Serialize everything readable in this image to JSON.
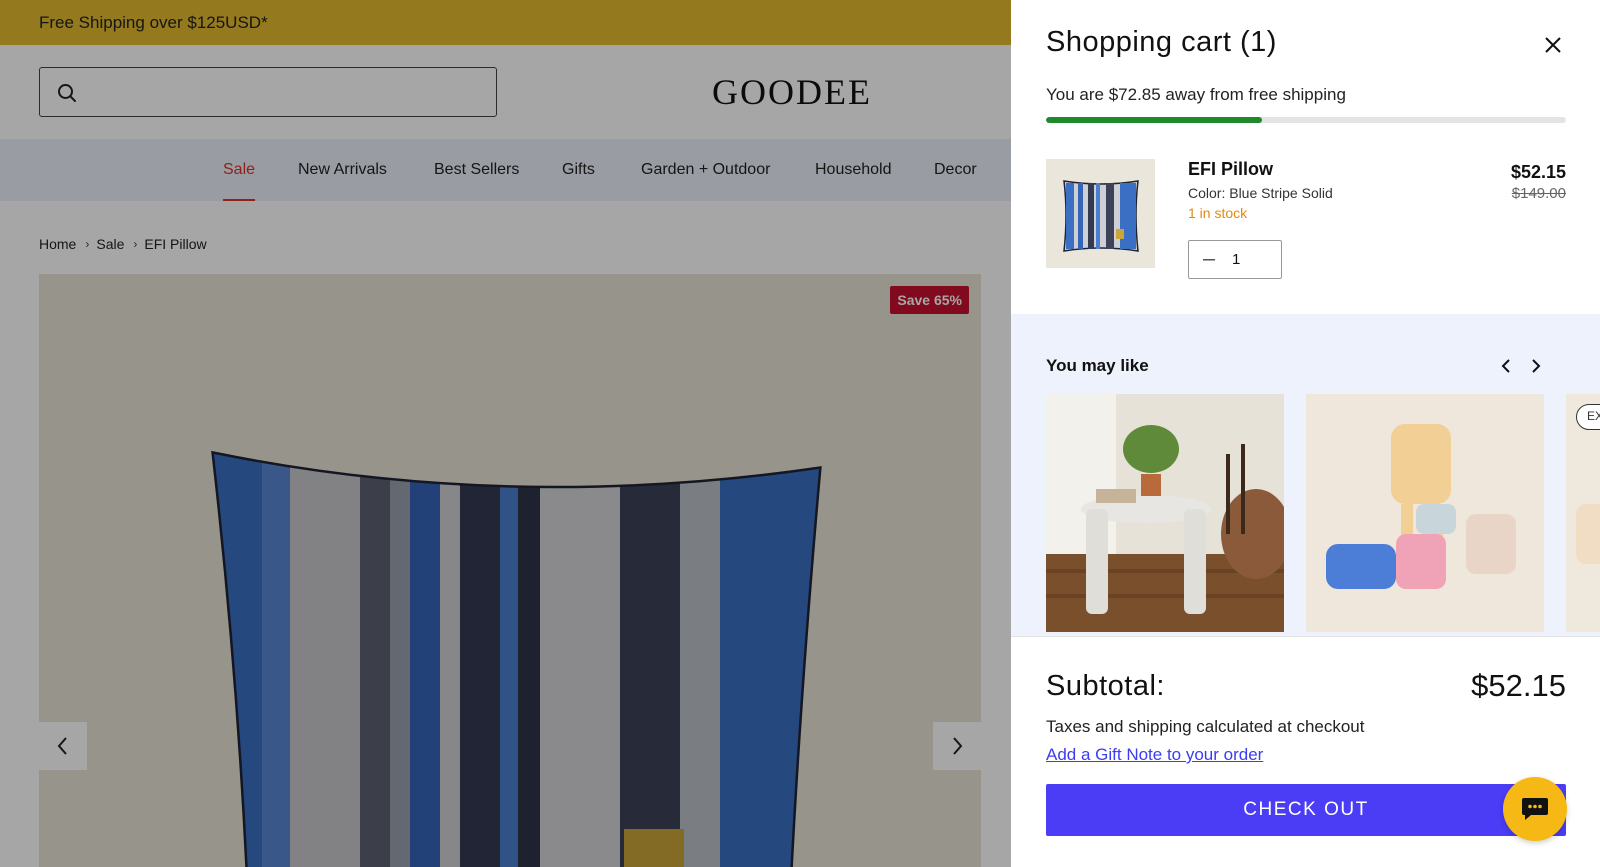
{
  "promo": {
    "text": "Free Shipping over $125USD*"
  },
  "header": {
    "logo": "GOODEE",
    "search_placeholder": ""
  },
  "nav": {
    "items": [
      {
        "label": "Sale",
        "active": true
      },
      {
        "label": "New Arrivals"
      },
      {
        "label": "Best Sellers"
      },
      {
        "label": "Gifts"
      },
      {
        "label": "Garden + Outdoor"
      },
      {
        "label": "Household"
      },
      {
        "label": "Decor"
      }
    ]
  },
  "breadcrumb": [
    "Home",
    "Sale",
    "EFI Pillow"
  ],
  "gallery": {
    "badge": "Save 65%"
  },
  "cart": {
    "title": "Shopping cart (1)",
    "shipping_message": "You are $72.85 away from free shipping",
    "shipping_progress": 0.415,
    "item": {
      "name": "EFI Pillow",
      "color": "Color: Blue Stripe Solid",
      "stock": "1 in stock",
      "price": "$52.15",
      "compare_price": "$149.00",
      "quantity": "1"
    },
    "recommendations": {
      "title": "You may like",
      "partial_badge": "EX"
    },
    "subtotal_label": "Subtotal:",
    "subtotal_value": "$52.15",
    "taxes_note": "Taxes and shipping calculated at checkout",
    "gift_note_link": "Add a Gift Note to your order",
    "checkout_label": "CHECK OUT"
  },
  "colors": {
    "promo": "#e3bb2e",
    "nav_bg": "#ecf1fa",
    "sale_red": "#d9342b",
    "progress_green": "#1f8a2b",
    "stock_orange": "#e08a10",
    "checkout": "#4b3cf5",
    "link": "#3d3df0",
    "chat": "#f5b814"
  },
  "icons": {
    "search": "search-icon",
    "close": "close-icon",
    "prev": "chevron-left-icon",
    "next": "chevron-right-icon",
    "chat": "chat-icon"
  }
}
